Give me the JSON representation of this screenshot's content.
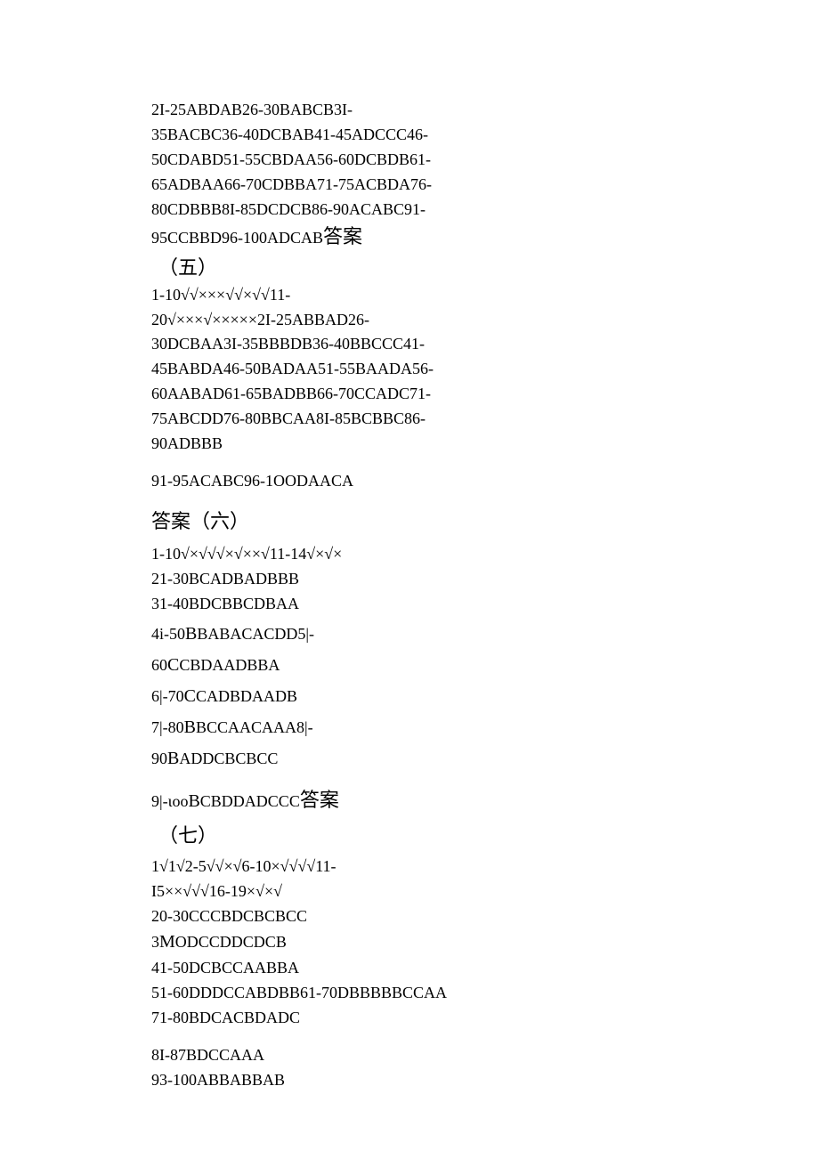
{
  "block4": {
    "l1": "2I-25ABDAB26-30BABCB3I-",
    "l2": "35BACBC36-40DCBAB41-45ADCCC46-",
    "l3": "50CDABD51-55CBDAA56-60DCBDB61-",
    "l4": "65ADBAA66-70CDBBA71-75ACBDA76-",
    "l5": "80CDBBB8I-85DCDCB86-90ACABC91-",
    "l6a": "95CCBBD96-100ADCAB",
    "l6b": "答案",
    "l7": "（五）",
    "l8": "1-10√√×××√√×√√11-",
    "l9": "20√×××√×××××2I-25ABBAD26-",
    "l10": "30DCBAA3I-35BBBDB36-40BBCCC41-",
    "l11": "45BABDA46-50BADAA51-55BAADA56-",
    "l12": "60AABAD61-65BADBB66-70CCADC71-",
    "l13": "75ABCDD76-80BBCAA8I-85BCBBC86-",
    "l14": "90ADBBB"
  },
  "line5": "91-95ACABC96-1OODAACA",
  "heading6": "答案（六）",
  "block6": {
    "l1": "1-10√×√√√×√××√11-14√×√×",
    "l2": "21-30BCADBADBBB",
    "l3": "31-40BDCBBCDBAA",
    "l4a": "4i-50",
    "l4b": "B",
    "l4c": "BABACACDD5|-",
    "l5a": "60",
    "l5b": "C",
    "l5c": "CBDAADBBA",
    "l6a": "6|-70",
    "l6b": "C",
    "l6c": "CADBDAADB",
    "l7a": "7|-80",
    "l7b": "B",
    "l7c": "BCCAACAAA8|-",
    "l8a": "90",
    "l8b": "B",
    "l8c": "ADDCBCBCC"
  },
  "block6b": {
    "l1a": "9|-ιoo",
    "l1b": "B",
    "l1c": "CBDDADCCC",
    "l1d": "答案",
    "l2": "（七）"
  },
  "block7": {
    "l1": "1√1√2-5√√×√6-10×√√√√11-",
    "l2": "I5××√√√16-19×√×√",
    "l3": "20-30CCCBDCBCBCC",
    "l4a": "3",
    "l4b": "M",
    "l4c": "ODCCDDCDCB",
    "l5": "41-50DCBCCAABBA",
    "l6": "51-60DDDCCABDBB61-70DBBBBBCCAA",
    "l7": "71-80BDCACBDADC"
  },
  "block7b": {
    "l1": "8I-87BDCCAAA",
    "l2": "93-100ABBABBAB"
  }
}
